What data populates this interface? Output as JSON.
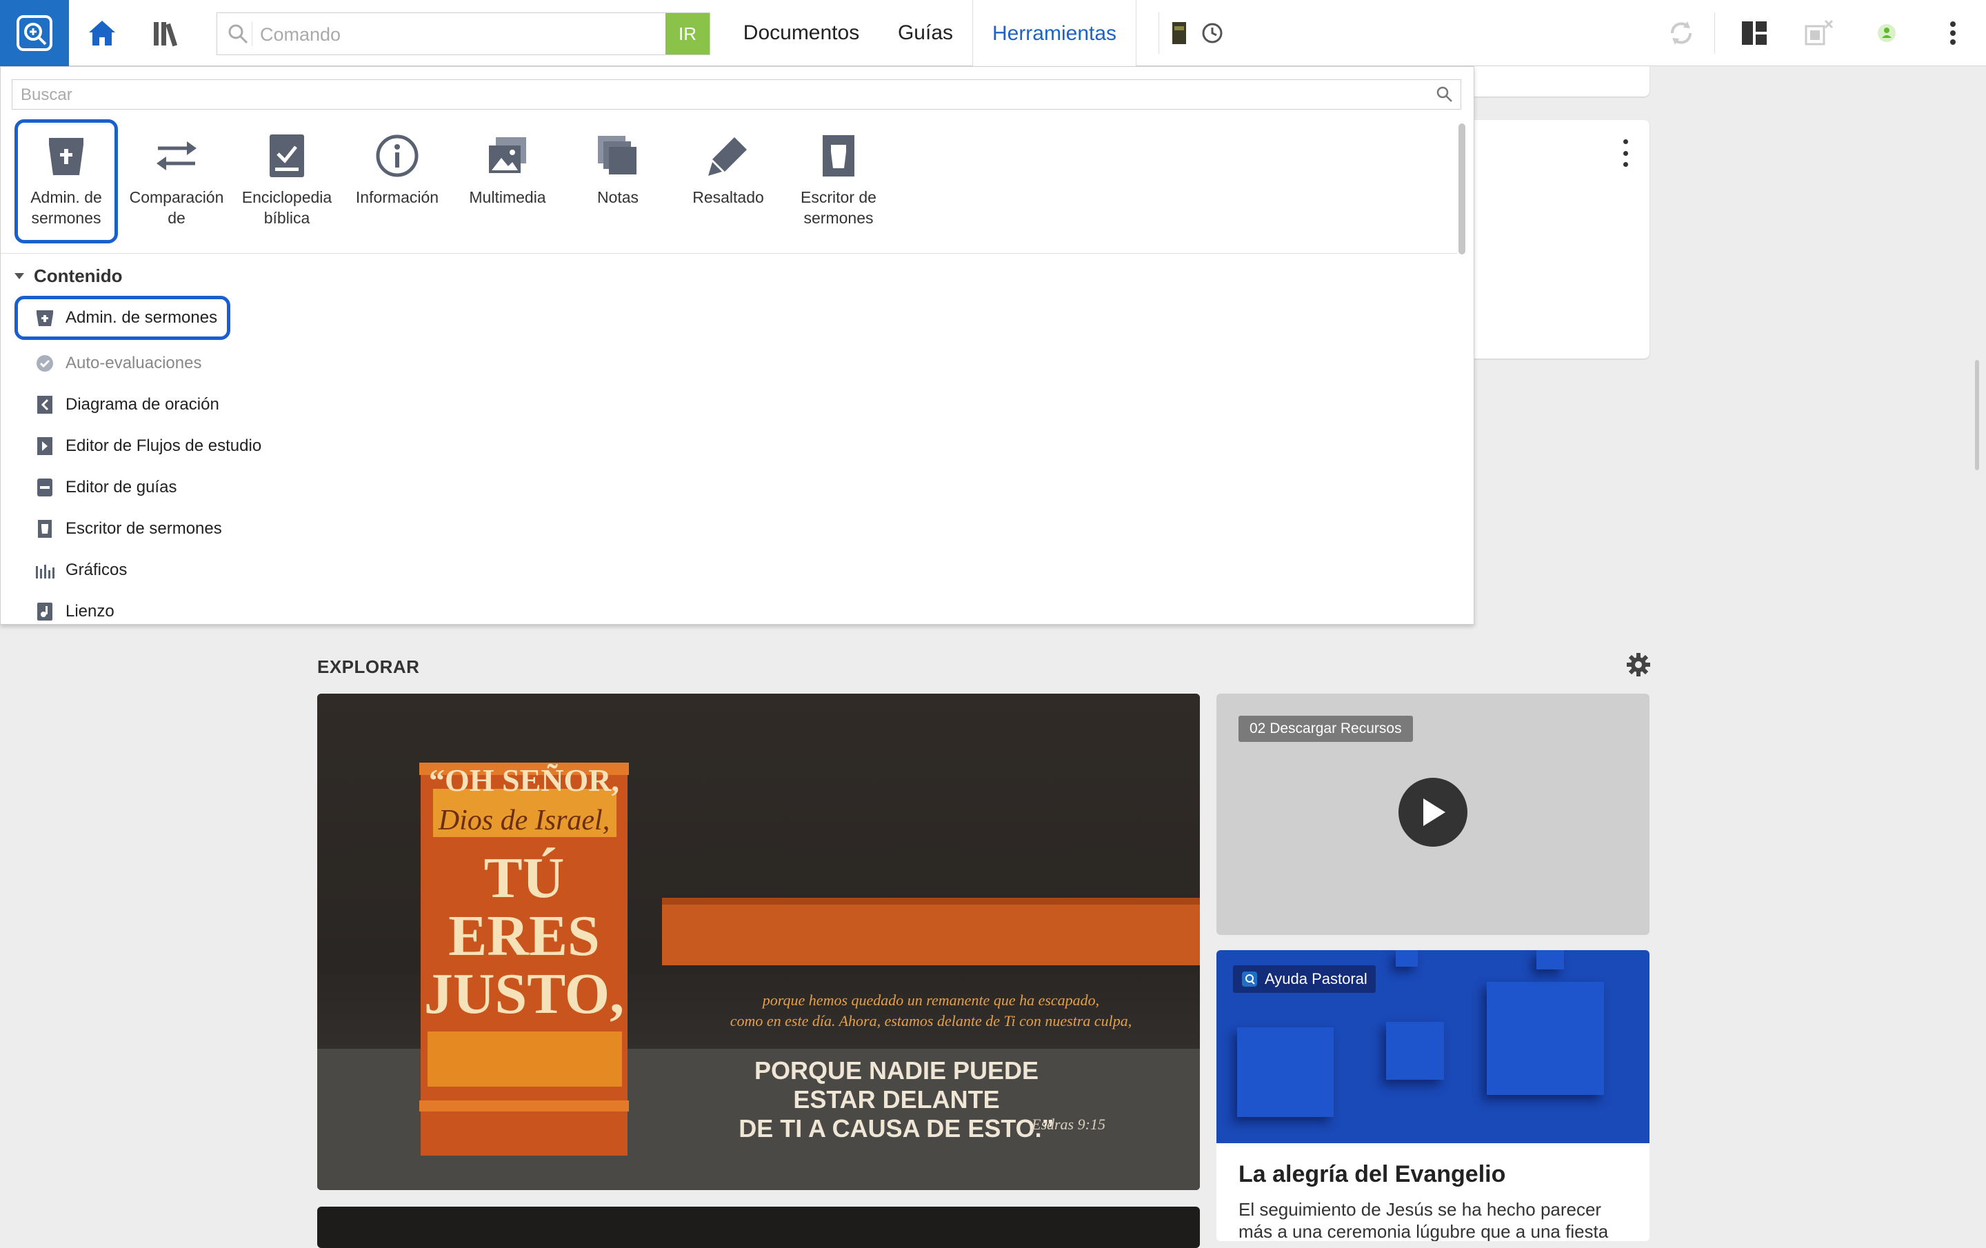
{
  "toolbar": {
    "command_placeholder": "Comando",
    "go_label": "IR",
    "tabs": [
      {
        "label": "Documentos"
      },
      {
        "label": "Guías"
      },
      {
        "label": "Herramientas",
        "active": true
      }
    ],
    "icons": [
      "app-logo-icon",
      "home-icon",
      "library-icon",
      "book-icon",
      "history-icon",
      "sync-icon",
      "layout-icon",
      "close-panels-icon",
      "user-status-icon",
      "more-menu-icon"
    ],
    "accent_color": "#1a64c8",
    "go_color": "#8bc34a"
  },
  "tools_panel": {
    "search_placeholder": "Buscar",
    "grid": [
      {
        "label": "Admin. de sermones",
        "icon": "sermon-manager-icon",
        "selected": true
      },
      {
        "label": "Comparación de",
        "icon": "compare-arrows-icon"
      },
      {
        "label": "Enciclopedia bíblica",
        "icon": "encyclopedia-icon"
      },
      {
        "label": "Información",
        "icon": "info-icon"
      },
      {
        "label": "Multimedia",
        "icon": "multimedia-icon"
      },
      {
        "label": "Notas",
        "icon": "notes-icon"
      },
      {
        "label": "Resaltado",
        "icon": "highlighter-icon"
      },
      {
        "label": "Escritor de sermones",
        "icon": "sermon-writer-icon"
      }
    ],
    "section_title": "Contenido",
    "items": [
      {
        "label": "Admin. de sermones",
        "icon": "sermon-manager-icon",
        "selected": true
      },
      {
        "label": "Auto-evaluaciones",
        "icon": "self-assessment-icon",
        "dim": true
      },
      {
        "label": "Diagrama de oración",
        "icon": "sentence-diagram-icon"
      },
      {
        "label": "Editor de Flujos de estudio",
        "icon": "study-flow-icon"
      },
      {
        "label": "Editor de guías",
        "icon": "guide-editor-icon"
      },
      {
        "label": "Escritor de sermones",
        "icon": "sermon-writer-icon"
      },
      {
        "label": "Gráficos",
        "icon": "graphics-icon"
      },
      {
        "label": "Lienzo",
        "icon": "canvas-icon"
      }
    ],
    "selection_color": "#1a5fd0"
  },
  "explore": {
    "title": "EXPLORAR",
    "hero": {
      "line1": "“OH SEÑOR,",
      "line2": "Dios de Israel,",
      "line3": "TÚ",
      "line4": "ERES",
      "line5": "JUSTO,",
      "small1": "porque hemos quedado un remanente que ha escapado,",
      "small2": "como en este día. Ahora, estamos delante de Ti con nuestra culpa,",
      "big1": "PORQUE NADIE PUEDE",
      "big2": "ESTAR DELANTE",
      "big3": "DE TI A CAUSA DE ESTO.”",
      "ref": "Esdras 9:15"
    },
    "video": {
      "badge": "02 Descargar Recursos"
    },
    "pastoral": {
      "badge": "Ayuda Pastoral",
      "title": "La alegría del Evangelio",
      "description": "El seguimiento de Jesús se ha hecho parecer más a una ceremonia lúgubre que a una fiesta"
    }
  }
}
